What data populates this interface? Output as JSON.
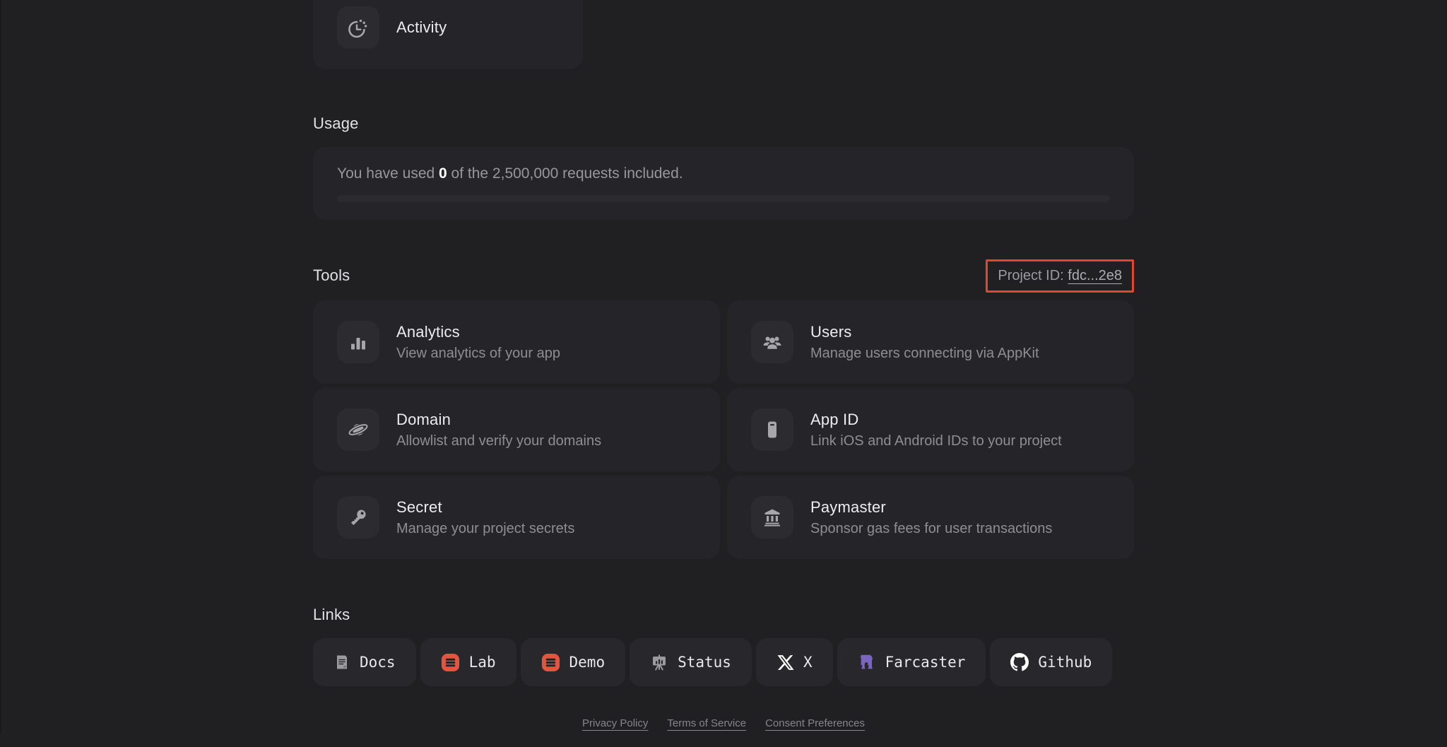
{
  "colors": {
    "background": "#202023",
    "card": "#252529",
    "highlight_red": "#E2462E",
    "reown_orange": "#E5543E",
    "farcaster_purple": "#7C65C1"
  },
  "activity_card": {
    "label": "Activity",
    "icon": "activity-timer-icon"
  },
  "usage": {
    "title": "Usage",
    "text_prefix": "You have used ",
    "used_count": "0",
    "text_suffix": " of the 2,500,000 requests included.",
    "progress_percent": 0
  },
  "tools": {
    "title": "Tools",
    "project_id_label": "Project ID: ",
    "project_id_value": "fdc...2e8",
    "cards": [
      {
        "title": "Analytics",
        "subtitle": "View analytics of your app",
        "icon": "bar-chart-icon"
      },
      {
        "title": "Users",
        "subtitle": "Manage users connecting via AppKit",
        "icon": "users-icon"
      },
      {
        "title": "Domain",
        "subtitle": "Allowlist and verify your domains",
        "icon": "planet-icon"
      },
      {
        "title": "App ID",
        "subtitle": "Link iOS and Android IDs to your project",
        "icon": "phone-icon"
      },
      {
        "title": "Secret",
        "subtitle": "Manage your project secrets",
        "icon": "key-icon"
      },
      {
        "title": "Paymaster",
        "subtitle": "Sponsor gas fees for user transactions",
        "icon": "bank-icon"
      }
    ]
  },
  "links": {
    "title": "Links",
    "items": [
      {
        "label": "Docs",
        "icon": "docs-icon"
      },
      {
        "label": "Lab",
        "icon": "reown-logo-icon"
      },
      {
        "label": "Demo",
        "icon": "reown-logo-icon"
      },
      {
        "label": "Status",
        "icon": "status-board-icon"
      },
      {
        "label": "X",
        "icon": "x-logo-icon"
      },
      {
        "label": "Farcaster",
        "icon": "farcaster-logo-icon"
      },
      {
        "label": "Github",
        "icon": "github-logo-icon"
      }
    ]
  },
  "footer": {
    "links": [
      {
        "label": "Privacy Policy"
      },
      {
        "label": "Terms of Service"
      },
      {
        "label": "Consent Preferences"
      }
    ]
  }
}
